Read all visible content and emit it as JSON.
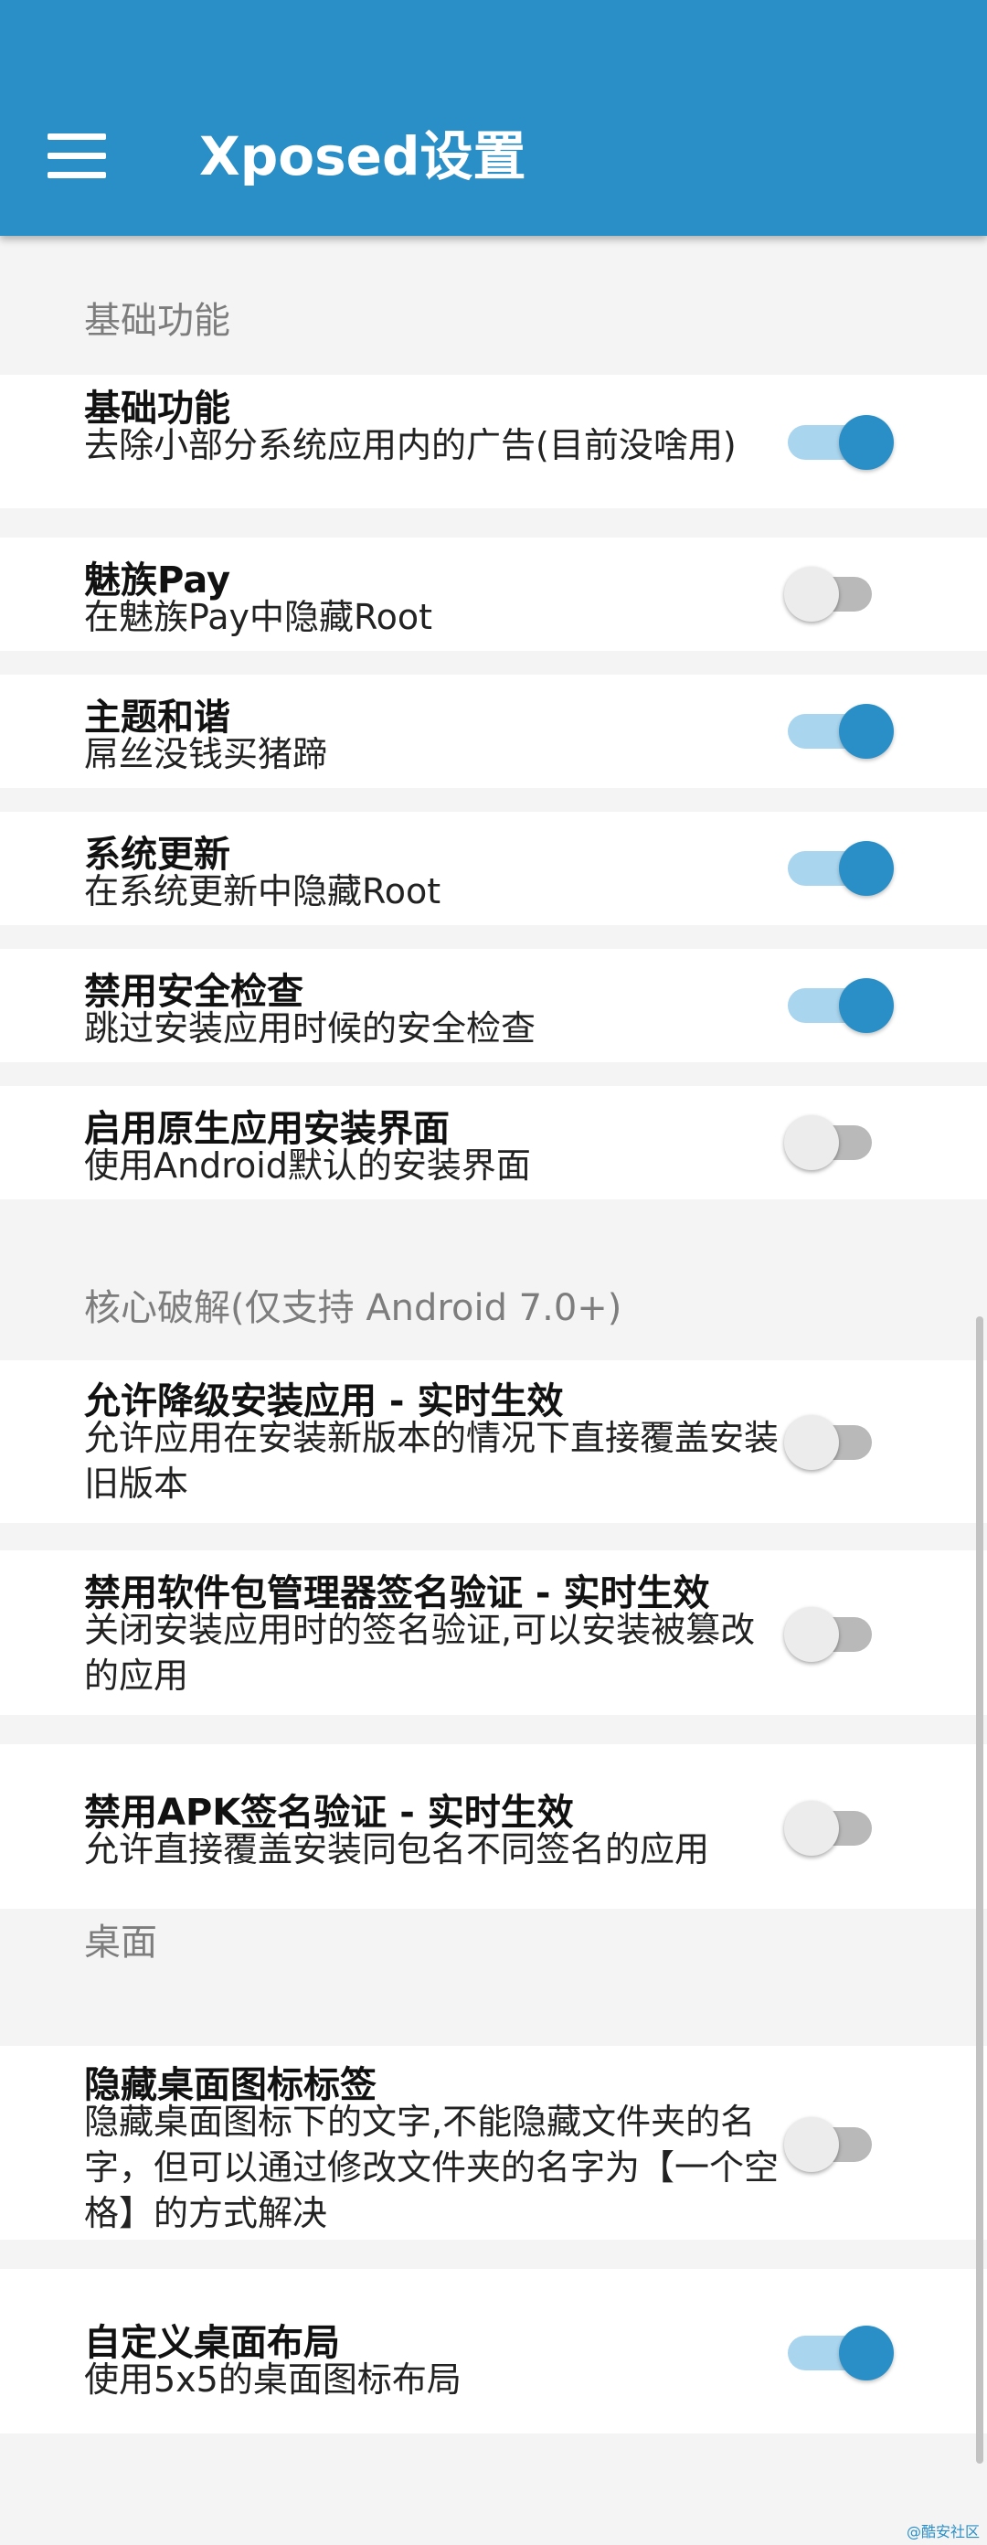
{
  "appbar": {
    "title": "Xposed设置",
    "menu_icon": "menu-icon",
    "color": "#2b8fc7"
  },
  "sections": [
    {
      "header": "基础功能",
      "items": [
        {
          "title": "基础功能",
          "summary": "去除小部分系统应用内的广告(目前没啥用)",
          "enabled": true
        },
        {
          "title": "魅族Pay",
          "summary": "在魅族Pay中隐藏Root",
          "enabled": false
        },
        {
          "title": "主题和谐",
          "summary": "屌丝没钱买猪蹄",
          "enabled": true
        },
        {
          "title": "系统更新",
          "summary": "在系统更新中隐藏Root",
          "enabled": true
        },
        {
          "title": "禁用安全检查",
          "summary": "跳过安装应用时候的安全检查",
          "enabled": true
        },
        {
          "title": "启用原生应用安装界面",
          "summary": "使用Android默认的安装界面",
          "enabled": false
        }
      ]
    },
    {
      "header": "核心破解(仅支持 Android 7.0+)",
      "items": [
        {
          "title": "允许降级安装应用 - 实时生效",
          "summary": "允许应用在安装新版本的情况下直接覆盖安装旧版本",
          "enabled": false
        },
        {
          "title": "禁用软件包管理器签名验证 - 实时生效",
          "summary": "关闭安装应用时的签名验证,可以安装被篡改的应用",
          "enabled": false
        },
        {
          "title": "禁用APK签名验证 - 实时生效",
          "summary": "允许直接覆盖安装同包名不同签名的应用",
          "enabled": false
        }
      ]
    },
    {
      "header": "桌面",
      "items": [
        {
          "title": "隐藏桌面图标标签",
          "summary": "隐藏桌面图标下的文字,不能隐藏文件夹的名字，但可以通过修改文件夹的名字为【一个空格】的方式解决",
          "enabled": false
        },
        {
          "title": "自定义桌面布局",
          "summary": "使用5x5的桌面图标布局",
          "enabled": true
        }
      ]
    }
  ],
  "watermark": "@酷安社区",
  "colors": {
    "accent": "#2b8fc7",
    "switch_on_track": "#a9d5ee",
    "switch_off_track": "#b9b9b9",
    "switch_off_thumb": "#ececec"
  }
}
